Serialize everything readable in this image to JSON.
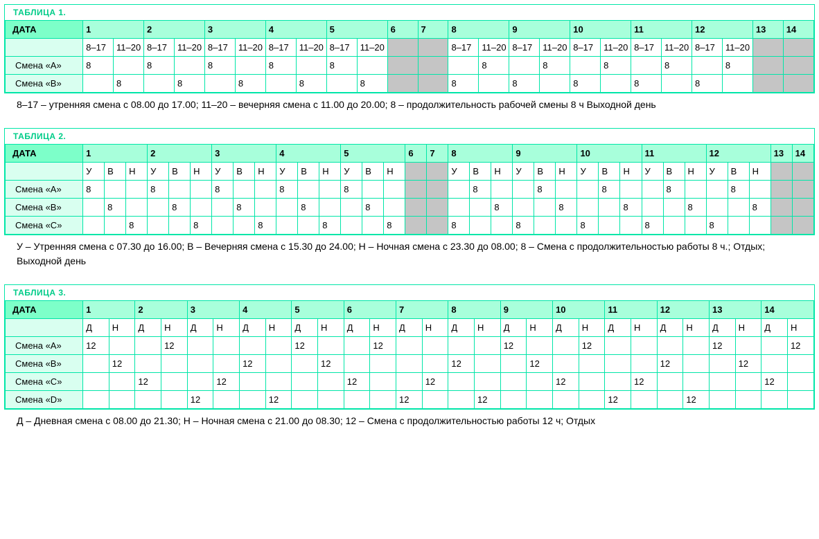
{
  "tables": [
    {
      "title": "ТАБЛИЦА 1.",
      "date_label": "ДАТА",
      "days": [
        "1",
        "2",
        "3",
        "4",
        "5",
        "6",
        "7",
        "8",
        "9",
        "10",
        "11",
        "12",
        "13",
        "14"
      ],
      "sub": [
        "8–17",
        "11–20",
        "8–17",
        "11–20",
        "8–17",
        "11–20",
        "8–17",
        "11–20",
        "8–17",
        "11–20",
        "",
        "",
        "8–17",
        "11–20",
        "8–17",
        "11–20",
        "8–17",
        "11–20",
        "8–17",
        "11–20",
        "8–17",
        "11–20",
        "",
        ""
      ],
      "rows": [
        {
          "label": "Смена «A»",
          "cells": [
            "8",
            "",
            "8",
            "",
            "8",
            "",
            "8",
            "",
            "8",
            "",
            "",
            "",
            "",
            "8",
            "",
            "8",
            "",
            "8",
            "",
            "8",
            "",
            "8",
            "",
            ""
          ]
        },
        {
          "label": "Смена «B»",
          "cells": [
            "",
            "8",
            "",
            "8",
            "",
            "8",
            "",
            "8",
            "",
            "8",
            "",
            "",
            "8",
            "",
            "8",
            "",
            "8",
            "",
            "8",
            "",
            "8",
            "",
            "",
            ""
          ]
        }
      ],
      "grey_days": [
        5,
        6,
        12,
        13
      ],
      "sub_per_day": 2,
      "narrow_days": [
        5,
        6,
        12,
        13
      ],
      "legend": "8–17 – утренняя смена с 08.00 до 17.00;  11–20 – вечерняя смена с 11.00 до 20.00;  8 – продолжительность рабочей смены 8 ч  Выходной день"
    },
    {
      "title": "ТАБЛИЦА 2.",
      "date_label": "ДАТА",
      "days": [
        "1",
        "2",
        "3",
        "4",
        "5",
        "6",
        "7",
        "8",
        "9",
        "10",
        "11",
        "12",
        "13",
        "14"
      ],
      "sub": [
        "У",
        "В",
        "Н",
        "У",
        "В",
        "Н",
        "У",
        "В",
        "Н",
        "У",
        "В",
        "Н",
        "У",
        "В",
        "Н",
        "",
        "",
        "У",
        "В",
        "Н",
        "У",
        "В",
        "Н",
        "У",
        "В",
        "Н",
        "У",
        "В",
        "Н",
        "У",
        "В",
        "Н",
        "",
        ""
      ],
      "rows": [
        {
          "label": "Смена «A»",
          "cells": [
            "8",
            "",
            "",
            "8",
            "",
            "",
            "8",
            "",
            "",
            "8",
            "",
            "",
            "8",
            "",
            "",
            "",
            "",
            "",
            "8",
            "",
            "",
            "8",
            "",
            "",
            "8",
            "",
            "",
            "8",
            "",
            "",
            "8",
            "",
            "",
            ""
          ]
        },
        {
          "label": "Смена «B»",
          "cells": [
            "",
            "8",
            "",
            "",
            "8",
            "",
            "",
            "8",
            "",
            "",
            "8",
            "",
            "",
            "8",
            "",
            "",
            "",
            "",
            "",
            "8",
            "",
            "",
            "8",
            "",
            "",
            "8",
            "",
            "",
            "8",
            "",
            "",
            "8",
            "",
            ""
          ]
        },
        {
          "label": "Смена «C»",
          "cells": [
            "",
            "",
            "8",
            "",
            "",
            "8",
            "",
            "",
            "8",
            "",
            "",
            "8",
            "",
            "",
            "8",
            "",
            "",
            "8",
            "",
            "",
            "8",
            "",
            "",
            "8",
            "",
            "",
            "8",
            "",
            "",
            "8",
            "",
            "",
            "",
            ""
          ]
        }
      ],
      "grey_days": [
        5,
        6,
        12,
        13
      ],
      "sub_per_day": 3,
      "narrow_days": [
        5,
        6,
        12,
        13
      ],
      "legend": "У – Утренняя смена с 07.30 до 16.00;  В – Вечерняя смена с 15.30 до 24.00;  Н – Ночная смена с 23.30 до 08.00;  8 – Смена с продолжительностью работы 8 ч.;  Отдых;  Выходной день"
    },
    {
      "title": "ТАБЛИЦА 3.",
      "date_label": "ДАТА",
      "days": [
        "1",
        "2",
        "3",
        "4",
        "5",
        "6",
        "7",
        "8",
        "9",
        "10",
        "11",
        "12",
        "13",
        "14"
      ],
      "sub": [
        "Д",
        "Н",
        "Д",
        "Н",
        "Д",
        "Н",
        "Д",
        "Н",
        "Д",
        "Н",
        "Д",
        "Н",
        "Д",
        "Н",
        "Д",
        "Н",
        "Д",
        "Н",
        "Д",
        "Н",
        "Д",
        "Н",
        "Д",
        "Н",
        "Д",
        "Н",
        "Д",
        "Н"
      ],
      "rows": [
        {
          "label": "Смена «A»",
          "cells": [
            "12",
            "",
            "",
            "12",
            "",
            "",
            "",
            "",
            "12",
            "",
            "",
            "12",
            "",
            "",
            "",
            "",
            "12",
            "",
            "",
            "12",
            "",
            "",
            "",
            "",
            "12",
            "",
            "",
            "12"
          ]
        },
        {
          "label": "Смена «B»",
          "cells": [
            "",
            "12",
            "",
            "",
            "",
            "",
            "12",
            "",
            "",
            "12",
            "",
            "",
            "",
            "",
            "12",
            "",
            "",
            "12",
            "",
            "",
            "",
            "",
            "12",
            "",
            "",
            "12",
            "",
            ""
          ]
        },
        {
          "label": "Смена «C»",
          "cells": [
            "",
            "",
            "12",
            "",
            "",
            "12",
            "",
            "",
            "",
            "",
            "12",
            "",
            "",
            "12",
            "",
            "",
            "",
            "",
            "12",
            "",
            "",
            "12",
            "",
            "",
            "",
            "",
            "12",
            ""
          ]
        },
        {
          "label": "Смена «D»",
          "cells": [
            "",
            "",
            "",
            "",
            "12",
            "",
            "",
            "12",
            "",
            "",
            "",
            "",
            "12",
            "",
            "",
            "12",
            "",
            "",
            "",
            "",
            "12",
            "",
            "",
            "12",
            "",
            "",
            "",
            ""
          ]
        }
      ],
      "grey_days": [],
      "sub_per_day": 2,
      "narrow_days": [],
      "legend": "Д – Дневная смена с 08.00 до 21.30;  Н – Ночная смена с 21.00 до 08.30;  12 – Смена с продолжительностью работы 12 ч;  Отдых"
    }
  ]
}
